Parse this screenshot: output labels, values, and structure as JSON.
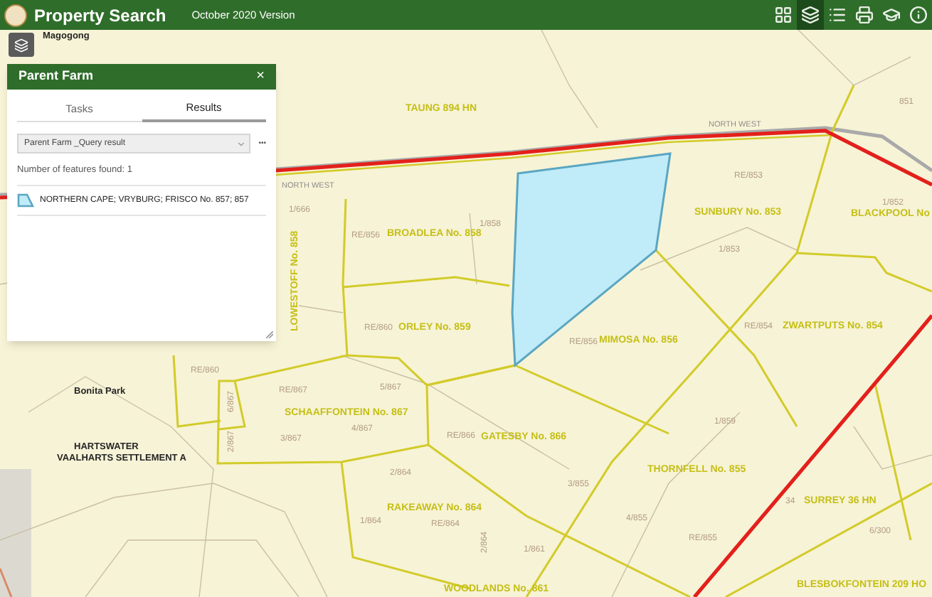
{
  "header": {
    "title": "Property Search",
    "subtitle": "October 2020 Version",
    "tools": [
      {
        "kind": "grid",
        "selected": false
      },
      {
        "kind": "layers",
        "selected": true
      },
      {
        "kind": "list",
        "selected": false
      },
      {
        "kind": "print",
        "selected": false
      },
      {
        "kind": "cap",
        "selected": false
      },
      {
        "kind": "info",
        "selected": false
      }
    ]
  },
  "widget": {
    "title": "Parent Farm",
    "close": "×",
    "tabs": [
      {
        "label": "Tasks",
        "selected": false
      },
      {
        "label": "Results",
        "selected": true
      }
    ],
    "query_select": "Parent Farm _Query result",
    "more": "•••",
    "count": "Number of features found: 1",
    "results": [
      "NORTHERN CAPE; VRYBURG; FRISCO No. 857; 857"
    ]
  },
  "map": {
    "labels": [
      {
        "kind": "place",
        "text": "Magogong"
      },
      {
        "kind": "farm",
        "text": "TAUNG 894 HN"
      },
      {
        "kind": "boundary",
        "text": "NORTH WEST"
      },
      {
        "kind": "boundary",
        "text": "NORTH WEST"
      },
      {
        "kind": "portion",
        "text": "851"
      },
      {
        "kind": "portion",
        "text": "RE/853"
      },
      {
        "kind": "farm",
        "text": "SUNBURY No. 853"
      },
      {
        "kind": "portion",
        "text": "1/852"
      },
      {
        "kind": "farm",
        "text": "BLACKPOOL No"
      },
      {
        "kind": "portion",
        "text": "1/853"
      },
      {
        "kind": "portion",
        "text": "1/666"
      },
      {
        "kind": "portion",
        "text": "RE/856"
      },
      {
        "kind": "farm",
        "text": "BROADLEA No. 858"
      },
      {
        "kind": "portion",
        "text": "1/858"
      },
      {
        "kind": "farm",
        "text": "LOWESTOFF No. 858"
      },
      {
        "kind": "portion",
        "text": "RE/860"
      },
      {
        "kind": "farm",
        "text": "ORLEY No. 859"
      },
      {
        "kind": "portion",
        "text": "RE/856"
      },
      {
        "kind": "farm",
        "text": "MIMOSA No. 856"
      },
      {
        "kind": "portion",
        "text": "RE/854"
      },
      {
        "kind": "farm",
        "text": "ZWARTPUTS No. 854"
      },
      {
        "kind": "portion",
        "text": "RE/860"
      },
      {
        "kind": "place",
        "text": "Bonita Park"
      },
      {
        "kind": "portion",
        "text": "RE/867"
      },
      {
        "kind": "portion",
        "text": "5/867"
      },
      {
        "kind": "farm",
        "text": "SCHAAFFONTEIN No. 867"
      },
      {
        "kind": "portion",
        "text": "4/867"
      },
      {
        "kind": "portion",
        "text": "3/867"
      },
      {
        "kind": "portion",
        "text": "6/867"
      },
      {
        "kind": "portion",
        "text": "2/867"
      },
      {
        "kind": "place",
        "text": "HARTSWATER"
      },
      {
        "kind": "place",
        "text": "VAALHARTS SETTLEMENT A"
      },
      {
        "kind": "portion",
        "text": "RE/866"
      },
      {
        "kind": "farm",
        "text": "GATESBY No. 866"
      },
      {
        "kind": "portion",
        "text": "1/859"
      },
      {
        "kind": "portion",
        "text": "2/864"
      },
      {
        "kind": "farm",
        "text": "RAKEAWAY No. 864"
      },
      {
        "kind": "portion",
        "text": "1/864"
      },
      {
        "kind": "portion",
        "text": "RE/864"
      },
      {
        "kind": "farm",
        "text": "THORNFELL No. 855"
      },
      {
        "kind": "portion",
        "text": "3/855"
      },
      {
        "kind": "portion",
        "text": "4/855"
      },
      {
        "kind": "portion",
        "text": "RE/855"
      },
      {
        "kind": "portion",
        "text": "34"
      },
      {
        "kind": "farm",
        "text": "SURREY 36 HN"
      },
      {
        "kind": "portion",
        "text": "6/300"
      },
      {
        "kind": "portion",
        "text": "1/861"
      },
      {
        "kind": "portion",
        "text": "2/864"
      },
      {
        "kind": "farm",
        "text": "WOODLANDS No. 861"
      },
      {
        "kind": "farm",
        "text": "BLESBOKFONTEIN 209 HO"
      }
    ]
  }
}
